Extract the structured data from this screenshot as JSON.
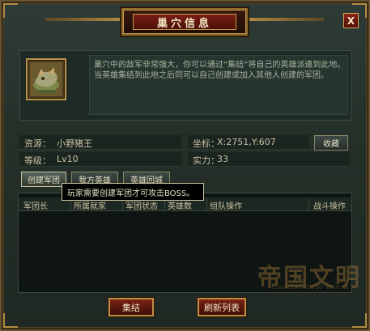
{
  "dialog": {
    "title": "巢穴信息",
    "close_glyph": "X"
  },
  "description": "巢穴中的敌军非常强大，你可以通过“集结”将自己的英雄派遣到此地。当英雄集结到此地之后同可以自己创建或加入其他人创建的军团。",
  "info": {
    "resource_label": "资源：",
    "resource_value": "小野猪王",
    "level_label": "等级：",
    "level_value": "Lv10",
    "coord_label": "坐标：",
    "coord_value": "X:2751,Y:607",
    "strength_label": "实力：",
    "strength_value": "33",
    "favorite_button": "收藏"
  },
  "tabs": [
    {
      "label": "创建军团"
    },
    {
      "label": "我方英雄"
    },
    {
      "label": "英雄回城"
    }
  ],
  "tooltip": "玩家需要创建军团才可攻击BOSS。",
  "table": {
    "columns": [
      "军团长",
      "所属就家",
      "军团状态",
      "英雄数",
      "组队操作",
      "战斗操作"
    ]
  },
  "watermark": {
    "text": "帝国文明",
    "sub": "CIVILIZATION OF EMPIRE"
  },
  "footer": {
    "rally_button": "集结",
    "refresh_button": "刷新列表"
  },
  "colors": {
    "frame_gold": "#b08a43",
    "title_red": "#7a1f14",
    "panel_green": "#253029"
  }
}
